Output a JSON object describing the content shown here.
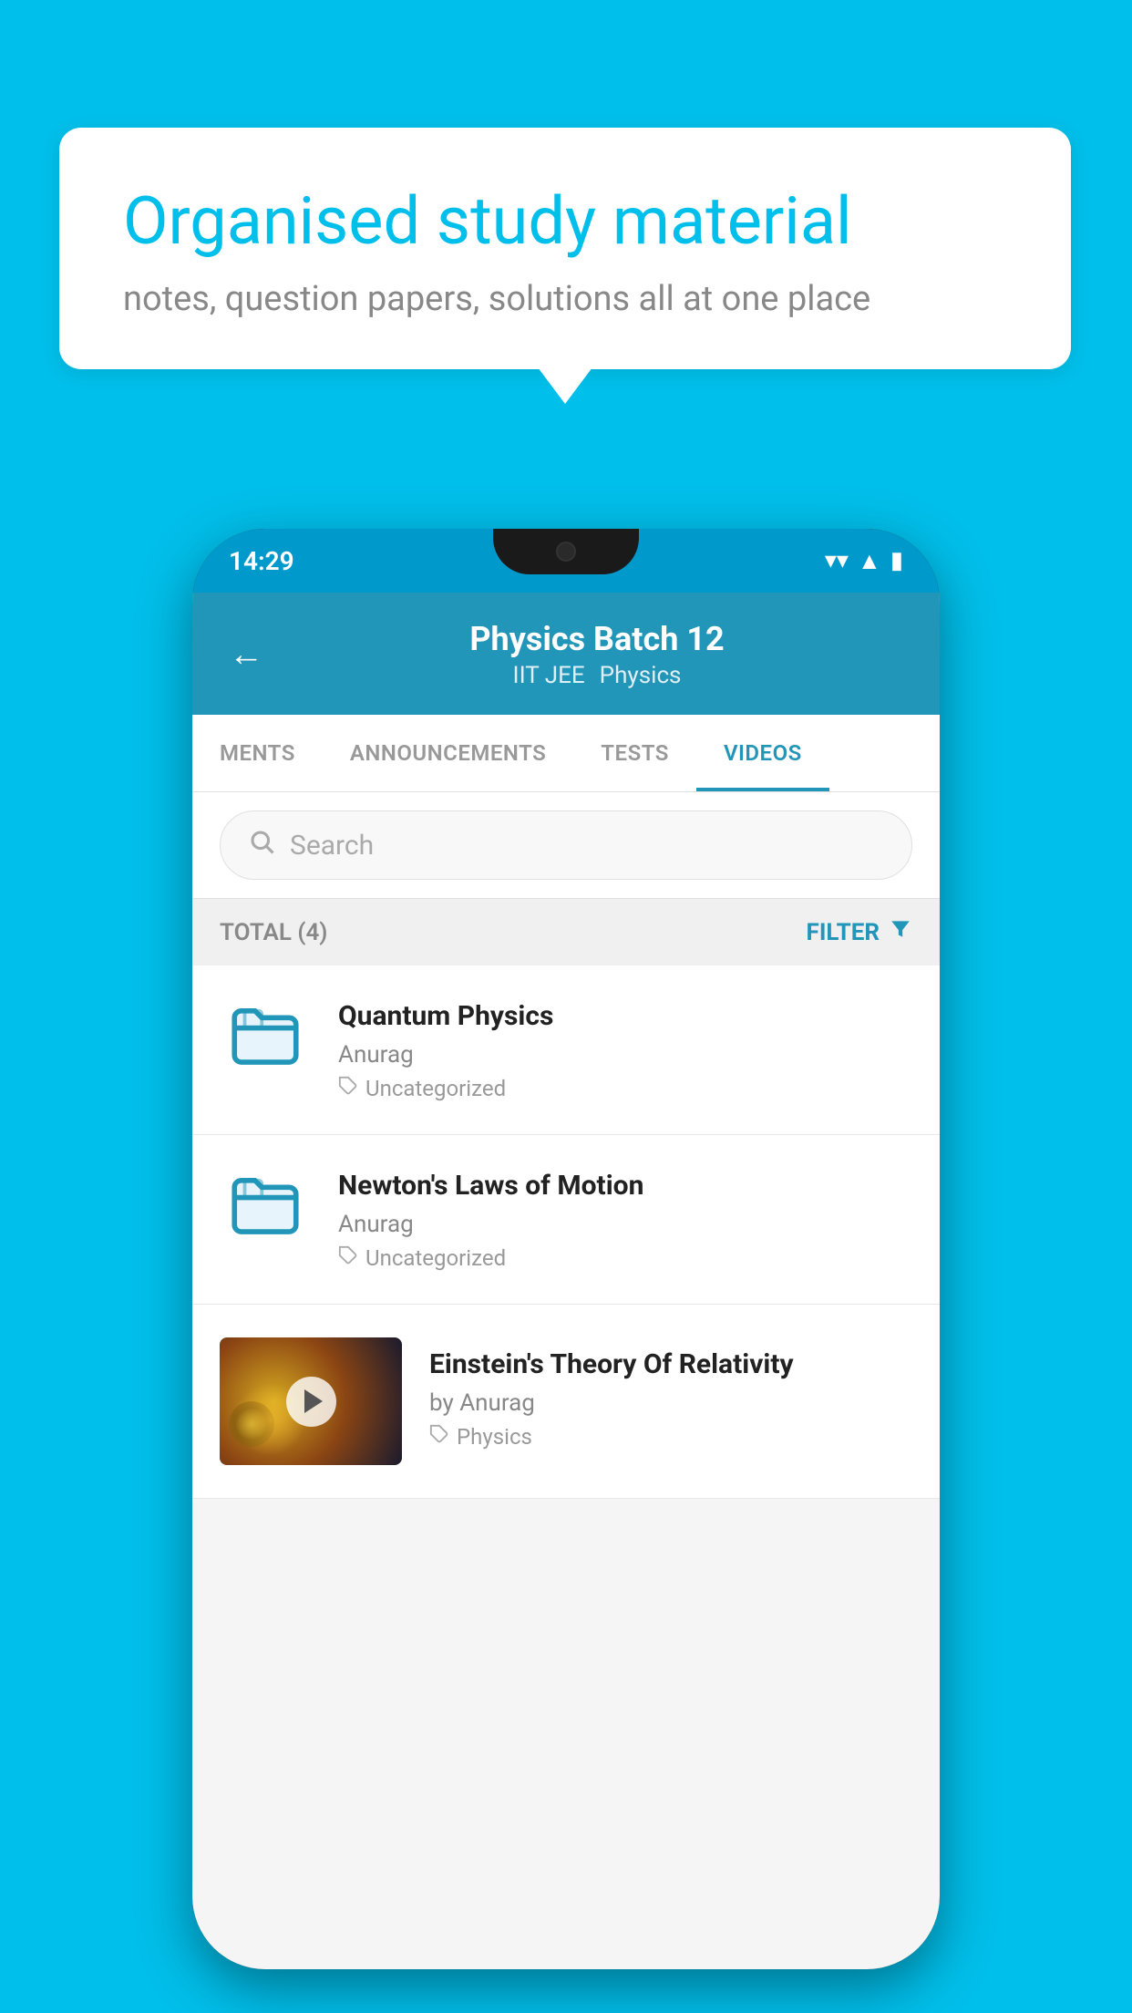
{
  "background_color": "#00BFEA",
  "info_card": {
    "title": "Organised study material",
    "subtitle": "notes, question papers, solutions all at one place"
  },
  "phone": {
    "status_bar": {
      "time": "14:29",
      "icons": [
        "wifi",
        "signal",
        "battery"
      ]
    },
    "header": {
      "title": "Physics Batch 12",
      "subtitle_left": "IIT JEE",
      "subtitle_right": "Physics",
      "back_label": "←"
    },
    "tabs": [
      {
        "label": "MENTS",
        "active": false
      },
      {
        "label": "ANNOUNCEMENTS",
        "active": false
      },
      {
        "label": "TESTS",
        "active": false
      },
      {
        "label": "VIDEOS",
        "active": true
      }
    ],
    "search": {
      "placeholder": "Search"
    },
    "filter_row": {
      "total_label": "TOTAL (4)",
      "filter_label": "FILTER"
    },
    "videos": [
      {
        "id": 1,
        "title": "Quantum Physics",
        "author": "Anurag",
        "tag": "Uncategorized",
        "type": "folder"
      },
      {
        "id": 2,
        "title": "Newton's Laws of Motion",
        "author": "Anurag",
        "tag": "Uncategorized",
        "type": "folder"
      },
      {
        "id": 3,
        "title": "Einstein's Theory Of Relativity",
        "author": "by Anurag",
        "tag": "Physics",
        "type": "video"
      }
    ]
  }
}
